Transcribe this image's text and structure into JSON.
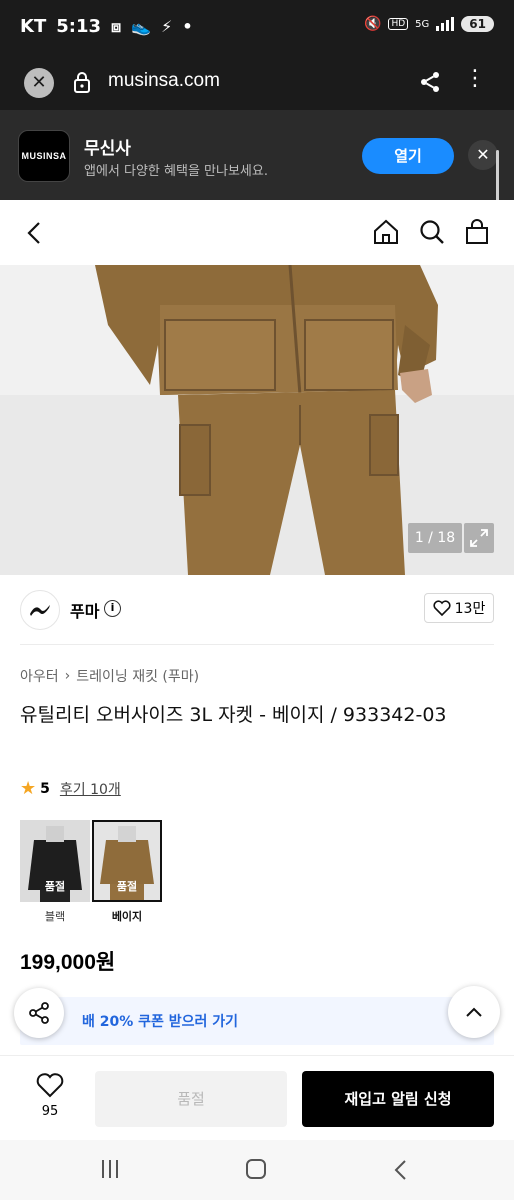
{
  "status_bar": {
    "carrier": "KT",
    "time": "5:13",
    "battery": "61",
    "net": "5G",
    "hd": "HD"
  },
  "browser": {
    "url": "musinsa.com"
  },
  "app_banner": {
    "logo_text": "MUSINSA",
    "name": "무신사",
    "description": "앱에서 다양한 혜택을 만나보세요.",
    "open_label": "열기"
  },
  "gallery": {
    "counter": "1 / 18"
  },
  "brand": {
    "name": "푸마",
    "likes": "13만"
  },
  "breadcrumb": {
    "category": "아우터",
    "subcategory": "트레이닝 재킷 (푸마)"
  },
  "product": {
    "title": "유틸리티 오버사이즈 3L 자켓 - 베이지 / 933342-03",
    "rating": "5",
    "reviews": "후기 10개",
    "price": "199,000원"
  },
  "swatches": [
    {
      "label": "블랙",
      "status": "품절",
      "selected": false
    },
    {
      "label": "베이지",
      "status": "품절",
      "selected": true
    }
  ],
  "coupon": {
    "text": "쿠폰받고 최대 20% 쿠폰 받으러 가기",
    "visible_text": "배 20% 쿠폰 받으러 가기"
  },
  "action_bar": {
    "like_count": "95",
    "soldout_label": "품절",
    "notify_label": "재입고 알림 신청"
  },
  "colors": {
    "accent_blue": "#1a8cff",
    "coupon_text": "#2266dd",
    "star": "#f5a623"
  }
}
